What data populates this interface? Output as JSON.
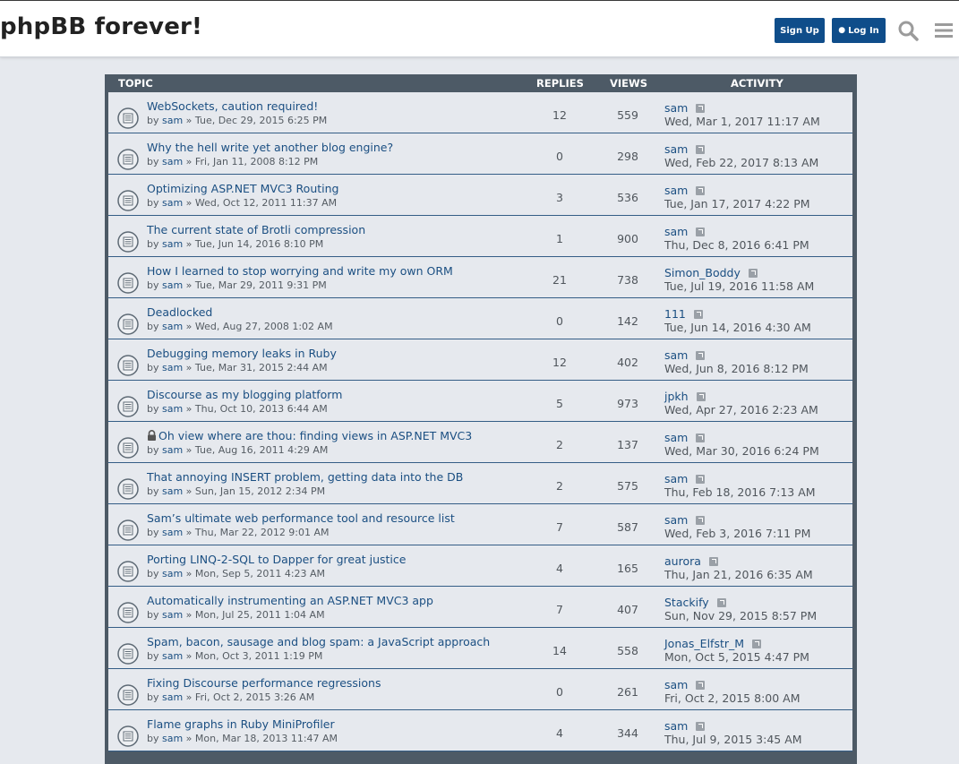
{
  "header": {
    "title": "phpBB forever!",
    "signup_label": "Sign Up",
    "login_label": "Log In",
    "accent_color": "#0f4d8a"
  },
  "table": {
    "col_topic": "TOPIC",
    "col_replies": "REPLIES",
    "col_views": "VIEWS",
    "col_activity": "ACTIVITY",
    "rows": [
      {
        "title": "WebSockets, caution required!",
        "author": "sam",
        "posted": "Tue, Dec 29, 2015 6:25 PM",
        "replies": "12",
        "views": "559",
        "last_user": "sam",
        "last_date": "Wed, Mar 1, 2017 11:17 AM",
        "locked": false
      },
      {
        "title": "Why the hell write yet another blog engine?",
        "author": "sam",
        "posted": "Fri, Jan 11, 2008 8:12 PM",
        "replies": "0",
        "views": "298",
        "last_user": "sam",
        "last_date": "Wed, Feb 22, 2017 8:13 AM",
        "locked": false
      },
      {
        "title": "Optimizing ASP.NET MVC3 Routing",
        "author": "sam",
        "posted": "Wed, Oct 12, 2011 11:37 AM",
        "replies": "3",
        "views": "536",
        "last_user": "sam",
        "last_date": "Tue, Jan 17, 2017 4:22 PM",
        "locked": false
      },
      {
        "title": "The current state of Brotli compression",
        "author": "sam",
        "posted": "Tue, Jun 14, 2016 8:10 PM",
        "replies": "1",
        "views": "900",
        "last_user": "sam",
        "last_date": "Thu, Dec 8, 2016 6:41 PM",
        "locked": false
      },
      {
        "title": "How I learned to stop worrying and write my own ORM",
        "author": "sam",
        "posted": "Tue, Mar 29, 2011 9:31 PM",
        "replies": "21",
        "views": "738",
        "last_user": "Simon_Boddy",
        "last_date": "Tue, Jul 19, 2016 11:58 AM",
        "locked": false
      },
      {
        "title": "Deadlocked",
        "author": "sam",
        "posted": "Wed, Aug 27, 2008 1:02 AM",
        "replies": "0",
        "views": "142",
        "last_user": "111",
        "last_date": "Tue, Jun 14, 2016 4:30 AM",
        "locked": false
      },
      {
        "title": "Debugging memory leaks in Ruby",
        "author": "sam",
        "posted": "Tue, Mar 31, 2015 2:44 AM",
        "replies": "12",
        "views": "402",
        "last_user": "sam",
        "last_date": "Wed, Jun 8, 2016 8:12 PM",
        "locked": false
      },
      {
        "title": "Discourse as my blogging platform",
        "author": "sam",
        "posted": "Thu, Oct 10, 2013 6:44 AM",
        "replies": "5",
        "views": "973",
        "last_user": "jpkh",
        "last_date": "Wed, Apr 27, 2016 2:23 AM",
        "locked": false
      },
      {
        "title": "Oh view where are thou: finding views in ASP.NET MVC3",
        "author": "sam",
        "posted": "Tue, Aug 16, 2011 4:29 AM",
        "replies": "2",
        "views": "137",
        "last_user": "sam",
        "last_date": "Wed, Mar 30, 2016 6:24 PM",
        "locked": true
      },
      {
        "title": "That annoying INSERT problem, getting data into the DB",
        "author": "sam",
        "posted": "Sun, Jan 15, 2012 2:34 PM",
        "replies": "2",
        "views": "575",
        "last_user": "sam",
        "last_date": "Thu, Feb 18, 2016 7:13 AM",
        "locked": false
      },
      {
        "title": "Sam’s ultimate web performance tool and resource list",
        "author": "sam",
        "posted": "Thu, Mar 22, 2012 9:01 AM",
        "replies": "7",
        "views": "587",
        "last_user": "sam",
        "last_date": "Wed, Feb 3, 2016 7:11 PM",
        "locked": false
      },
      {
        "title": "Porting LINQ-2-SQL to Dapper for great justice",
        "author": "sam",
        "posted": "Mon, Sep 5, 2011 4:23 AM",
        "replies": "4",
        "views": "165",
        "last_user": "aurora",
        "last_date": "Thu, Jan 21, 2016 6:35 AM",
        "locked": false
      },
      {
        "title": "Automatically instrumenting an ASP.NET MVC3 app",
        "author": "sam",
        "posted": "Mon, Jul 25, 2011 1:04 AM",
        "replies": "7",
        "views": "407",
        "last_user": "Stackify",
        "last_date": "Sun, Nov 29, 2015 8:57 PM",
        "locked": false
      },
      {
        "title": "Spam, bacon, sausage and blog spam: a JavaScript approach",
        "author": "sam",
        "posted": "Mon, Oct 3, 2011 1:19 PM",
        "replies": "14",
        "views": "558",
        "last_user": "Jonas_Elfstr_M",
        "last_date": "Mon, Oct 5, 2015 4:47 PM",
        "locked": false
      },
      {
        "title": "Fixing Discourse performance regressions",
        "author": "sam",
        "posted": "Fri, Oct 2, 2015 3:26 AM",
        "replies": "0",
        "views": "261",
        "last_user": "sam",
        "last_date": "Fri, Oct 2, 2015 8:00 AM",
        "locked": false
      },
      {
        "title": "Flame graphs in Ruby MiniProfiler",
        "author": "sam",
        "posted": "Mon, Mar 18, 2013 11:47 AM",
        "replies": "4",
        "views": "344",
        "last_user": "sam",
        "last_date": "Thu, Jul 9, 2015 3:45 AM",
        "locked": false
      }
    ]
  }
}
